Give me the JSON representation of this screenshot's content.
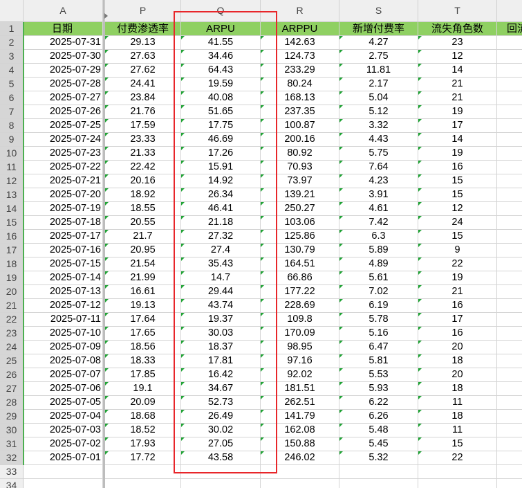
{
  "columns": [
    "A",
    "P",
    "Q",
    "R",
    "S",
    "T",
    ""
  ],
  "headers": [
    "日期",
    "付费渗透率",
    "ARPU",
    "ARPPU",
    "新增付费率",
    "流失角色数",
    "回流"
  ],
  "rows": [
    [
      "2025-07-31",
      "29.13",
      "41.55",
      "142.63",
      "4.27",
      "23"
    ],
    [
      "2025-07-30",
      "27.63",
      "34.46",
      "124.73",
      "2.75",
      "12"
    ],
    [
      "2025-07-29",
      "27.62",
      "64.43",
      "233.29",
      "11.81",
      "14"
    ],
    [
      "2025-07-28",
      "24.41",
      "19.59",
      "80.24",
      "2.17",
      "21"
    ],
    [
      "2025-07-27",
      "23.84",
      "40.08",
      "168.13",
      "5.04",
      "21"
    ],
    [
      "2025-07-26",
      "21.76",
      "51.65",
      "237.35",
      "5.12",
      "19"
    ],
    [
      "2025-07-25",
      "17.59",
      "17.75",
      "100.87",
      "3.32",
      "17"
    ],
    [
      "2025-07-24",
      "23.33",
      "46.69",
      "200.16",
      "4.43",
      "14"
    ],
    [
      "2025-07-23",
      "21.33",
      "17.26",
      "80.92",
      "5.75",
      "19"
    ],
    [
      "2025-07-22",
      "22.42",
      "15.91",
      "70.93",
      "7.64",
      "16"
    ],
    [
      "2025-07-21",
      "20.16",
      "14.92",
      "73.97",
      "4.23",
      "15"
    ],
    [
      "2025-07-20",
      "18.92",
      "26.34",
      "139.21",
      "3.91",
      "15"
    ],
    [
      "2025-07-19",
      "18.55",
      "46.41",
      "250.27",
      "4.61",
      "12"
    ],
    [
      "2025-07-18",
      "20.55",
      "21.18",
      "103.06",
      "7.42",
      "24"
    ],
    [
      "2025-07-17",
      "21.7",
      "27.32",
      "125.86",
      "6.3",
      "15"
    ],
    [
      "2025-07-16",
      "20.95",
      "27.4",
      "130.79",
      "5.89",
      "9"
    ],
    [
      "2025-07-15",
      "21.54",
      "35.43",
      "164.51",
      "4.89",
      "22"
    ],
    [
      "2025-07-14",
      "21.99",
      "14.7",
      "66.86",
      "5.61",
      "19"
    ],
    [
      "2025-07-13",
      "16.61",
      "29.44",
      "177.22",
      "7.02",
      "21"
    ],
    [
      "2025-07-12",
      "19.13",
      "43.74",
      "228.69",
      "6.19",
      "16"
    ],
    [
      "2025-07-11",
      "17.64",
      "19.37",
      "109.8",
      "5.78",
      "17"
    ],
    [
      "2025-07-10",
      "17.65",
      "30.03",
      "170.09",
      "5.16",
      "16"
    ],
    [
      "2025-07-09",
      "18.56",
      "18.37",
      "98.95",
      "6.47",
      "20"
    ],
    [
      "2025-07-08",
      "18.33",
      "17.81",
      "97.16",
      "5.81",
      "18"
    ],
    [
      "2025-07-07",
      "17.85",
      "16.42",
      "92.02",
      "5.53",
      "20"
    ],
    [
      "2025-07-06",
      "19.1",
      "34.67",
      "181.51",
      "5.93",
      "18"
    ],
    [
      "2025-07-05",
      "20.09",
      "52.73",
      "262.51",
      "6.22",
      "11"
    ],
    [
      "2025-07-04",
      "18.68",
      "26.49",
      "141.79",
      "6.26",
      "18"
    ],
    [
      "2025-07-03",
      "18.52",
      "30.02",
      "162.08",
      "5.48",
      "11"
    ],
    [
      "2025-07-02",
      "17.93",
      "27.05",
      "150.88",
      "5.45",
      "15"
    ],
    [
      "2025-07-01",
      "17.72",
      "43.58",
      "246.02",
      "5.32",
      "22"
    ]
  ],
  "row_numbers": [
    "1",
    "2",
    "3",
    "4",
    "5",
    "6",
    "7",
    "8",
    "9",
    "10",
    "11",
    "12",
    "13",
    "14",
    "15",
    "16",
    "17",
    "18",
    "19",
    "20",
    "21",
    "22",
    "23",
    "24",
    "25",
    "26",
    "27",
    "28",
    "29",
    "30",
    "31",
    "32",
    "33",
    "34"
  ],
  "colors": {
    "header_fill": "#8fd062",
    "highlight_border": "#e8262a",
    "error_triangle": "#21a336"
  }
}
